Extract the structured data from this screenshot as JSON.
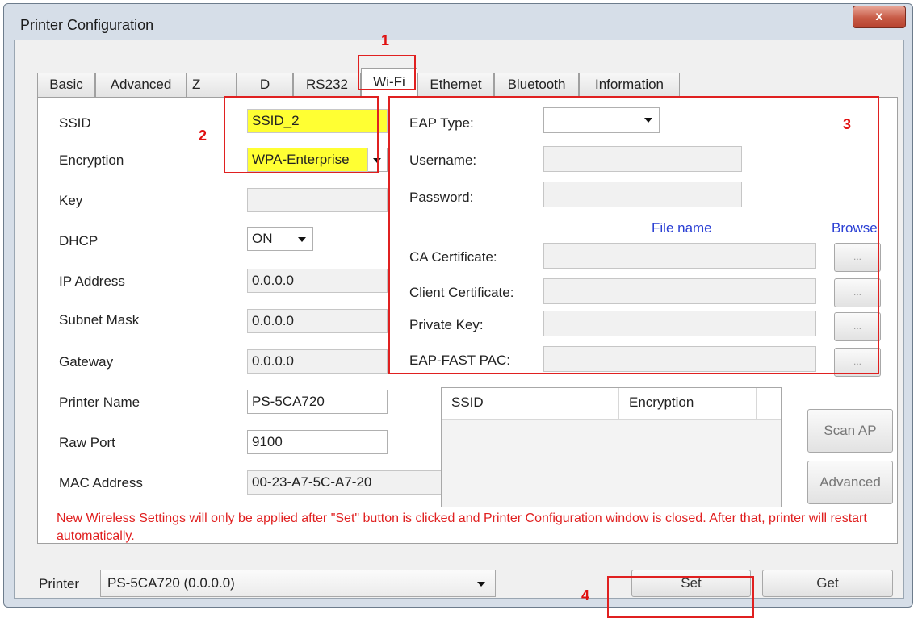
{
  "window": {
    "title": "Printer Configuration",
    "close_label": "x"
  },
  "tabs": [
    {
      "label": "Basic"
    },
    {
      "label": "Advanced"
    },
    {
      "label": "Z"
    },
    {
      "label": "D"
    },
    {
      "label": "RS232"
    },
    {
      "label": "Wi-Fi"
    },
    {
      "label": "Ethernet"
    },
    {
      "label": "Bluetooth"
    },
    {
      "label": "Information"
    }
  ],
  "active_tab": "Wi-Fi",
  "wifi": {
    "ssid_label": "SSID",
    "ssid_value": "SSID_2",
    "encryption_label": "Encryption",
    "encryption_value": "WPA-Enterprise",
    "key_label": "Key",
    "key_value": "",
    "dhcp_label": "DHCP",
    "dhcp_value": "ON",
    "ip_label": "IP Address",
    "ip_value": "0.0.0.0",
    "subnet_label": "Subnet Mask",
    "subnet_value": "0.0.0.0",
    "gateway_label": "Gateway",
    "gateway_value": "0.0.0.0",
    "printer_name_label": "Printer Name",
    "printer_name_value": "PS-5CA720",
    "raw_port_label": "Raw Port",
    "raw_port_value": "9100",
    "mac_label": "MAC Address",
    "mac_value": "00-23-A7-5C-A7-20"
  },
  "eap": {
    "type_label": "EAP Type:",
    "type_value": "",
    "username_label": "Username:",
    "password_label": "Password:",
    "file_name_header": "File name",
    "browse_header": "Browse",
    "ca_label": "CA Certificate:",
    "client_label": "Client Certificate:",
    "private_key_label": "Private Key:",
    "eap_fast_label": "EAP-FAST PAC:",
    "browse_button_label": "..."
  },
  "ap_list": {
    "col_ssid": "SSID",
    "col_encryption": "Encryption",
    "scan_button": "Scan AP",
    "advanced_button": "Advanced"
  },
  "notice": "New Wireless Settings will only be applied after \"Set\" button is clicked and Printer Configuration window is closed. After that, printer will restart automatically.",
  "footer": {
    "printer_label": "Printer",
    "printer_value": "PS-5CA720 (0.0.0.0)",
    "set_button": "Set",
    "get_button": "Get"
  },
  "annotations": {
    "n1": "1",
    "n2": "2",
    "n3": "3",
    "n4": "4",
    "color": "#e02020"
  }
}
